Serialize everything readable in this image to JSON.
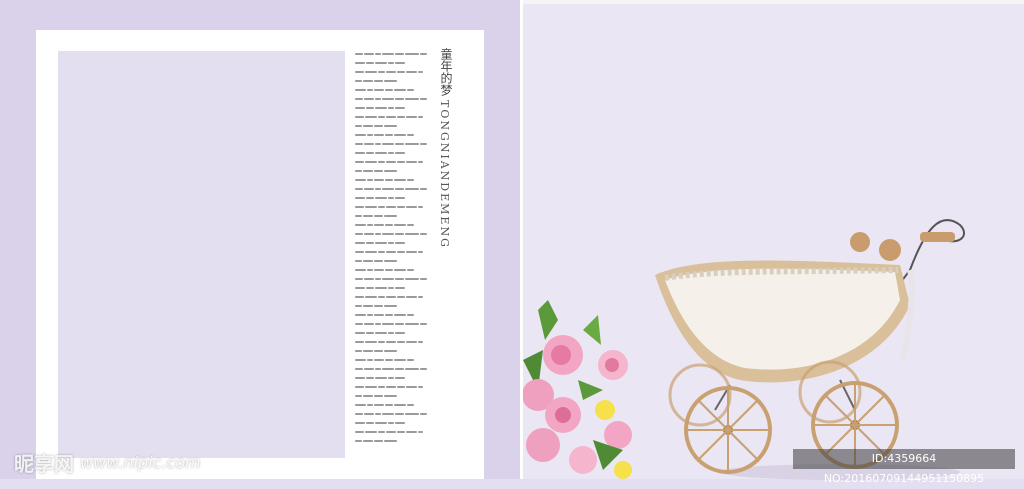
{
  "title": {
    "chinese": "童年的梦",
    "pinyin": "TONGNIANDEMENG"
  },
  "watermark": {
    "brand": "昵享网",
    "url": "www.nipic.com",
    "id_text": "ID:4359664 NO:20160709144951150895"
  },
  "colors": {
    "left_background": "#d9d2ea",
    "right_background": "#ebe6f3",
    "photo_placeholder": "#e3dff0"
  }
}
